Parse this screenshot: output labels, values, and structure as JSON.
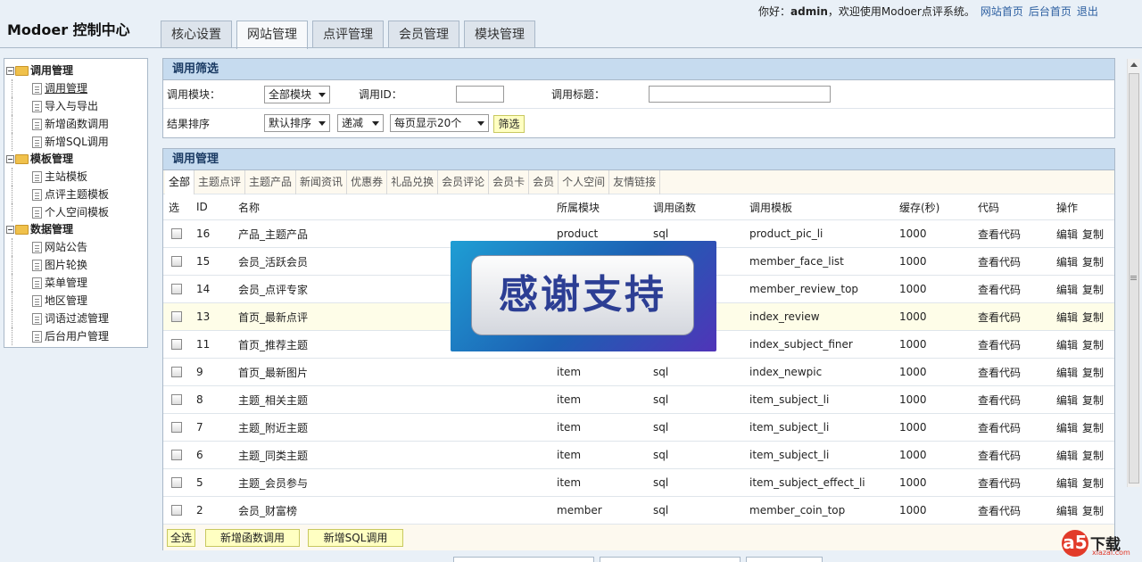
{
  "header": {
    "brand": "Modoer 控制中心",
    "tabs": [
      "核心设置",
      "网站管理",
      "点评管理",
      "会员管理",
      "模块管理"
    ],
    "active_tab": "网站管理",
    "welcome_prefix": "你好：",
    "username": "admin",
    "welcome_suffix": "，欢迎使用Modoer点评系统。",
    "links": [
      "网站首页",
      "后台首页",
      "退出"
    ]
  },
  "sidebar": {
    "groups": [
      {
        "title": "调用管理",
        "items": [
          "调用管理",
          "导入与导出",
          "新增函数调用",
          "新增SQL调用"
        ]
      },
      {
        "title": "模板管理",
        "items": [
          "主站模板",
          "点评主题模板",
          "个人空间模板"
        ]
      },
      {
        "title": "数据管理",
        "items": [
          "网站公告",
          "图片轮换",
          "菜单管理",
          "地区管理",
          "词语过滤管理",
          "后台用户管理"
        ]
      }
    ]
  },
  "filter": {
    "title": "调用筛选",
    "module_label": "调用模块：",
    "module_value": "全部模块",
    "id_label": "调用ID：",
    "id_value": "",
    "title_label": "调用标题：",
    "title_value": "",
    "sort_label": "结果排序",
    "sort_value": "默认排序",
    "order_value": "递减",
    "per_page_value": "每页显示20个",
    "submit_label": "筛选"
  },
  "list": {
    "title": "调用管理",
    "categories": [
      "全部",
      "主题点评",
      "主题产品",
      "新闻资讯",
      "优惠券",
      "礼品兑换",
      "会员评论",
      "会员卡",
      "会员",
      "个人空间",
      "友情链接"
    ],
    "columns": [
      "选",
      "ID",
      "名称",
      "所属模块",
      "调用函数",
      "调用模板",
      "缓存(秒)",
      "代码",
      "操作"
    ],
    "rows": [
      {
        "id": "16",
        "name": "产品_主题产品",
        "module": "product",
        "func": "sql",
        "template": "product_pic_li",
        "cache": "1000"
      },
      {
        "id": "15",
        "name": "会员_活跃会员",
        "module": "",
        "func": "",
        "template": "member_face_list",
        "cache": "1000"
      },
      {
        "id": "14",
        "name": "会员_点评专家",
        "module": "",
        "func": "",
        "template": "member_review_top",
        "cache": "1000"
      },
      {
        "id": "13",
        "name": "首页_最新点评",
        "module": "",
        "func": "",
        "template": "index_review",
        "cache": "1000"
      },
      {
        "id": "11",
        "name": "首页_推荐主题",
        "module": "",
        "func": "",
        "template": "index_subject_finer",
        "cache": "1000"
      },
      {
        "id": "9",
        "name": "首页_最新图片",
        "module": "item",
        "func": "sql",
        "template": "index_newpic",
        "cache": "1000"
      },
      {
        "id": "8",
        "name": "主题_相关主题",
        "module": "item",
        "func": "sql",
        "template": "item_subject_li",
        "cache": "1000"
      },
      {
        "id": "7",
        "name": "主题_附近主题",
        "module": "item",
        "func": "sql",
        "template": "item_subject_li",
        "cache": "1000"
      },
      {
        "id": "6",
        "name": "主题_同类主题",
        "module": "item",
        "func": "sql",
        "template": "item_subject_li",
        "cache": "1000"
      },
      {
        "id": "5",
        "name": "主题_会员参与",
        "module": "item",
        "func": "sql",
        "template": "item_subject_effect_li",
        "cache": "1000"
      },
      {
        "id": "2",
        "name": "会员_财富榜",
        "module": "member",
        "func": "sql",
        "template": "member_coin_top",
        "cache": "1000"
      }
    ],
    "view_code_label": "查看代码",
    "edit_label": "编辑",
    "copy_label": "复制",
    "footer_buttons": [
      "全选",
      "新增函数调用",
      "新增SQL调用"
    ]
  },
  "overlay": {
    "text": "感谢支持"
  },
  "watermark": {
    "mark": "a5",
    "text": "下载",
    "sub": "xiazai.com"
  }
}
